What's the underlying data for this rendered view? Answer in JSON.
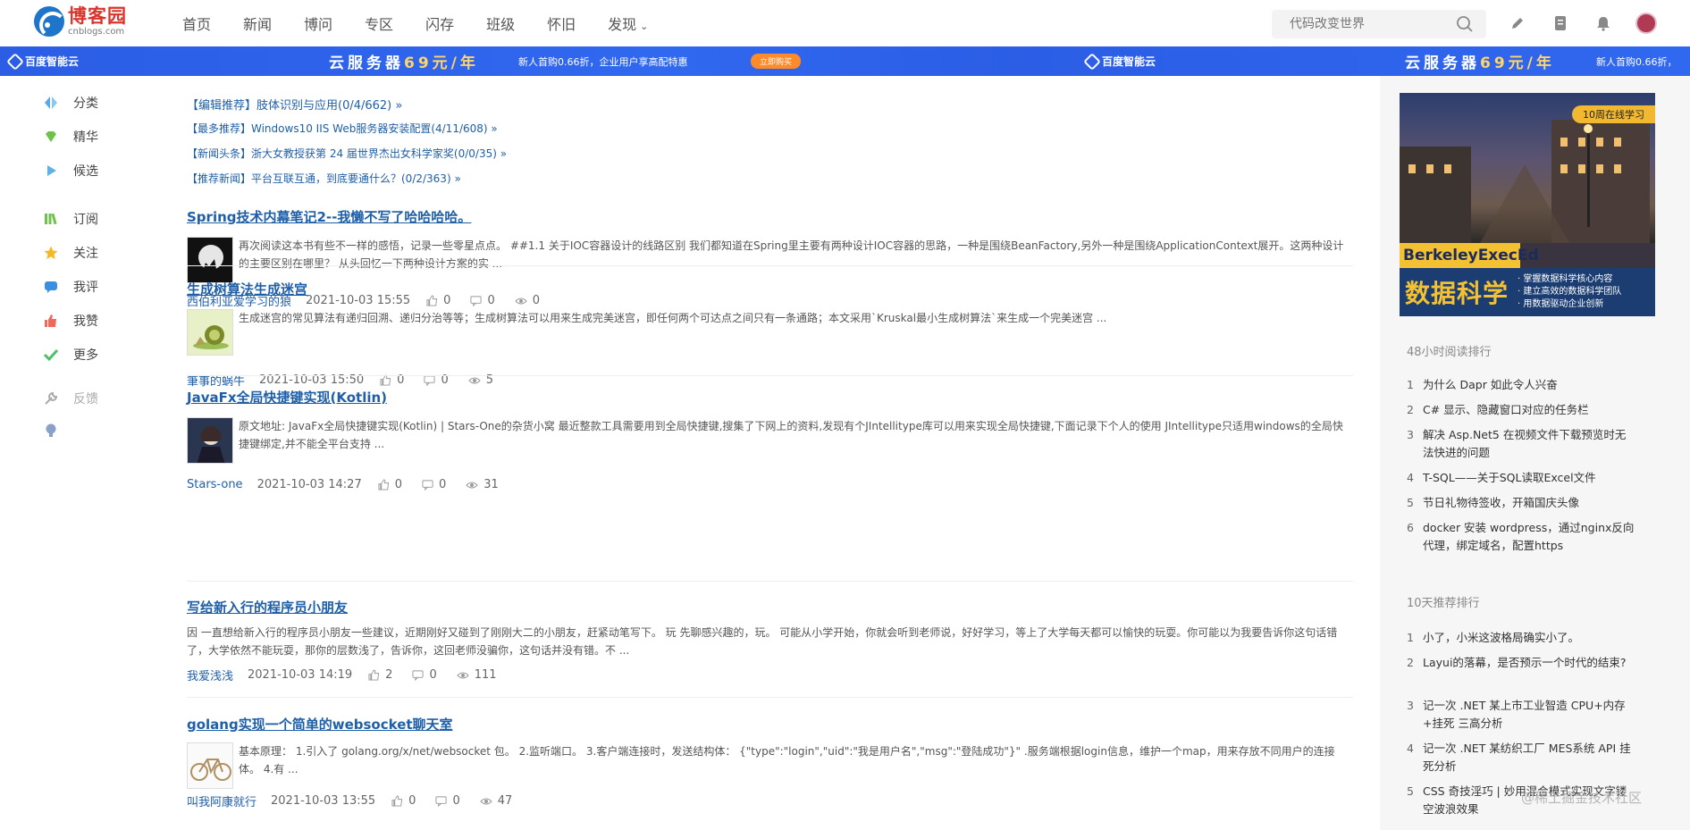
{
  "logo": {
    "cn": "博客园",
    "en": "cnblogs.com"
  },
  "nav": {
    "items": [
      "首页",
      "新闻",
      "博问",
      "专区",
      "闪存",
      "班级",
      "怀旧",
      "发现"
    ],
    "search_placeholder": "代码改变世界"
  },
  "banner": {
    "brand": "百度智能云",
    "title_prefix": "云服务器",
    "title_price": "69元/年",
    "sub": "新人首购0.66折，企业用户享高配特惠",
    "button": "立即购买",
    "sub_short": "新人首购0.66折，"
  },
  "leftbar": {
    "items": [
      {
        "label": "分类",
        "icon": "category-icon"
      },
      {
        "label": "精华",
        "icon": "gem-icon"
      },
      {
        "label": "候选",
        "icon": "play-icon"
      },
      {
        "label": "订阅",
        "icon": "books-icon"
      },
      {
        "label": "关注",
        "icon": "star-icon"
      },
      {
        "label": "我评",
        "icon": "comment-icon"
      },
      {
        "label": "我赞",
        "icon": "thumbs-up-icon"
      },
      {
        "label": "更多",
        "icon": "check-icon"
      },
      {
        "label": "反馈",
        "icon": "wrench-icon"
      }
    ]
  },
  "recommend": [
    "【编辑推荐】肢体识别与应用(0/4/662) »",
    "【最多推荐】Windows10 IIS Web服务器安装配置(4/11/608) »",
    "【新闻头条】浙大女教授获第 24 届世界杰出女科学家奖(0/0/35) »",
    "【推荐新闻】平台互联互通，到底要通什么？(0/2/363) »"
  ],
  "posts": [
    {
      "title": "Spring技术内幕笔记2--我懒不写了哈哈哈哈。",
      "summary": "再次阅读这本书有些不一样的感悟，记录一些零星点点。 ##1.1 关于IOC容器设计的线路区别 我们都知道在Spring里主要有两种设计IOC容器的思路，一种是围绕BeanFactory,另外一种是围绕ApplicationContext展开。这两种设计的主要区别在哪里？ 从头回忆一下两种设计方案的实 ...",
      "author": "西伯利亚爱学习的狼",
      "date": "2021-10-03 15:55",
      "likes": "0",
      "comments": "0",
      "views": "0"
    },
    {
      "title": "生成树算法生成迷宫",
      "summary": "生成迷宫的常见算法有递归回溯、递归分治等等；生成树算法可以用来生成完美迷宫，即任何两个可达点之间只有一条通路；本文采用`Kruskal最小生成树算法`来生成一个完美迷宫 ...",
      "author": "筆事的蜗牛",
      "date": "2021-10-03 15:50",
      "likes": "0",
      "comments": "0",
      "views": "5"
    },
    {
      "title": "JavaFx全局快捷键实现(Kotlin)",
      "summary": "原文地址: JavaFx全局快捷键实现(Kotlin) | Stars-One的杂货小窝 最近整款工具需要用到全局快捷键,搜集了下网上的资料,发现有个JIntellitype库可以用来实现全局快捷键,下面记录下个人的使用 JIntellitype只适用windows的全局快捷键绑定,并不能全平台支持 ...",
      "author": "Stars-one",
      "date": "2021-10-03 14:27",
      "likes": "0",
      "comments": "0",
      "views": "31"
    },
    {
      "title": "写给新入行的程序员小朋友",
      "summary": "因 一直想给新入行的程序员小朋友一些建议，近期刚好又碰到了刚刚大二的小朋友，赶紧动笔写下。 玩 先聊感兴趣的，玩。 可能从小学开始，你就会听到老师说，好好学习，等上了大学每天都可以愉快的玩耍。你可能以为我要告诉你这句话错了，大学依然不能玩耍，那你的层数浅了，告诉你，这回老师没骗你，这句话并没有错。不 ...",
      "author": "我爱浅浅",
      "date": "2021-10-03 14:19",
      "likes": "2",
      "comments": "0",
      "views": "111"
    },
    {
      "title": "golang实现一个简单的websocket聊天室",
      "summary": "基本原理： 1.引入了 golang.org/x/net/websocket 包。 2.监听端口。 3.客户端连接时，发送结构体： {\"type\":\"login\",\"uid\":\"我是用户名\",\"msg\":\"登陆成功\"}\" .服务端根据login信息，维护一个map，用来存放不同用户的连接体。 4.有 ...",
      "author": "叫我阿康就行",
      "date": "2021-10-03 13:55",
      "likes": "0",
      "comments": "0",
      "views": "47"
    }
  ],
  "ad": {
    "badge": "10周在线学习",
    "brand": "BerkeleyExecEd",
    "big": "数据科学",
    "points": [
      "· 掌握数据科学核心内容",
      "· 建立高效的数据科学团队",
      "· 用数据驱动企业创新"
    ]
  },
  "ranking48": {
    "title": "48小时阅读排行",
    "items": [
      {
        "num": "1",
        "text": "为什么 Dapr 如此令人兴奋"
      },
      {
        "num": "2",
        "text": "C# 显示、隐藏窗口对应的任务栏"
      },
      {
        "num": "3",
        "text": "解决 Asp.Net5 在视频文件下载预览时无法快进的问题"
      },
      {
        "num": "4",
        "text": "T-SQL——关于SQL读取Excel文件"
      },
      {
        "num": "5",
        "text": "节日礼物待签收，开箱国庆头像"
      },
      {
        "num": "6",
        "text": "docker 安装 wordpress，通过nginx反向代理，绑定域名，配置https"
      }
    ]
  },
  "ranking10": {
    "title": "10天推荐排行",
    "items": [
      {
        "num": "1",
        "text": "小了，小米这波格局确实小了。"
      },
      {
        "num": "2",
        "text": "Layui的落幕，是否预示一个时代的结束?"
      },
      {
        "num": "3",
        "text": "记一次 .NET 某上市工业智造 CPU+内存+挂死 三高分析"
      },
      {
        "num": "4",
        "text": "记一次 .NET 某纺织工厂 MES系统 API 挂死分析"
      },
      {
        "num": "5",
        "text": "CSS 奇技淫巧 | 妙用混合模式实现文字镂空波浪效果"
      }
    ]
  },
  "watermark": "@稀土掘金技术社区"
}
